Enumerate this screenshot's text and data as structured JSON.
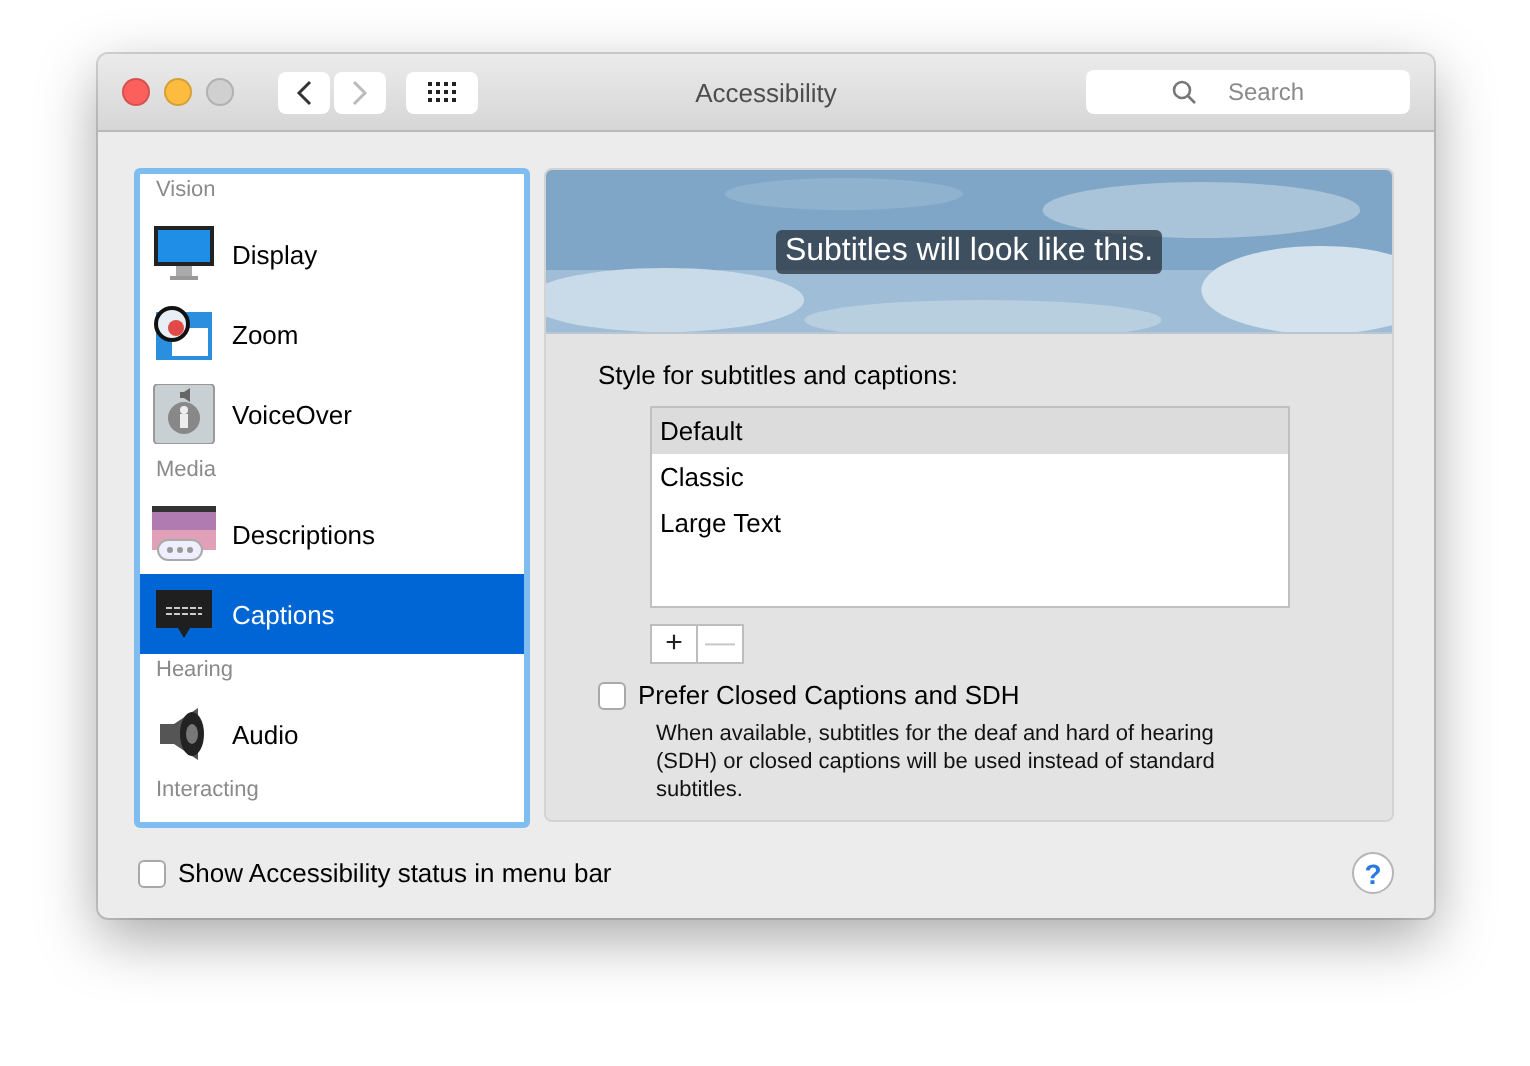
{
  "window": {
    "title": "Accessibility",
    "search": {
      "placeholder": "Search"
    }
  },
  "sidebar": {
    "items": [
      {
        "kind": "header",
        "label": "Vision"
      },
      {
        "kind": "item",
        "label": "Display",
        "selected": false
      },
      {
        "kind": "item",
        "label": "Zoom",
        "selected": false
      },
      {
        "kind": "item",
        "label": "VoiceOver",
        "selected": false
      },
      {
        "kind": "header",
        "label": "Media"
      },
      {
        "kind": "item",
        "label": "Descriptions",
        "selected": false
      },
      {
        "kind": "item",
        "label": "Captions",
        "selected": true
      },
      {
        "kind": "header",
        "label": "Hearing"
      },
      {
        "kind": "item",
        "label": "Audio",
        "selected": false
      },
      {
        "kind": "header",
        "label": "Interacting"
      }
    ]
  },
  "preview": {
    "kind": "picture",
    "caption": "Subtitles will look like this."
  },
  "styles": {
    "label": "Style for subtitles and captions:",
    "items": [
      {
        "label": "Default",
        "selected": true
      },
      {
        "label": "Classic",
        "selected": false
      },
      {
        "label": "Large Text",
        "selected": false
      }
    ],
    "buttons": [
      {
        "label": "+",
        "disabled": false
      },
      {
        "label": "—",
        "disabled": true
      }
    ]
  },
  "prefer_sdh": {
    "label": "Prefer Closed Captions and SDH",
    "checked": false,
    "description": "When available, subtitles for the deaf and hard of hearing (SDH) or closed captions will be used instead of standard subtitles."
  },
  "show_status": {
    "label": "Show Accessibility status in menu bar",
    "checked": false
  },
  "help": {
    "label": "?"
  }
}
